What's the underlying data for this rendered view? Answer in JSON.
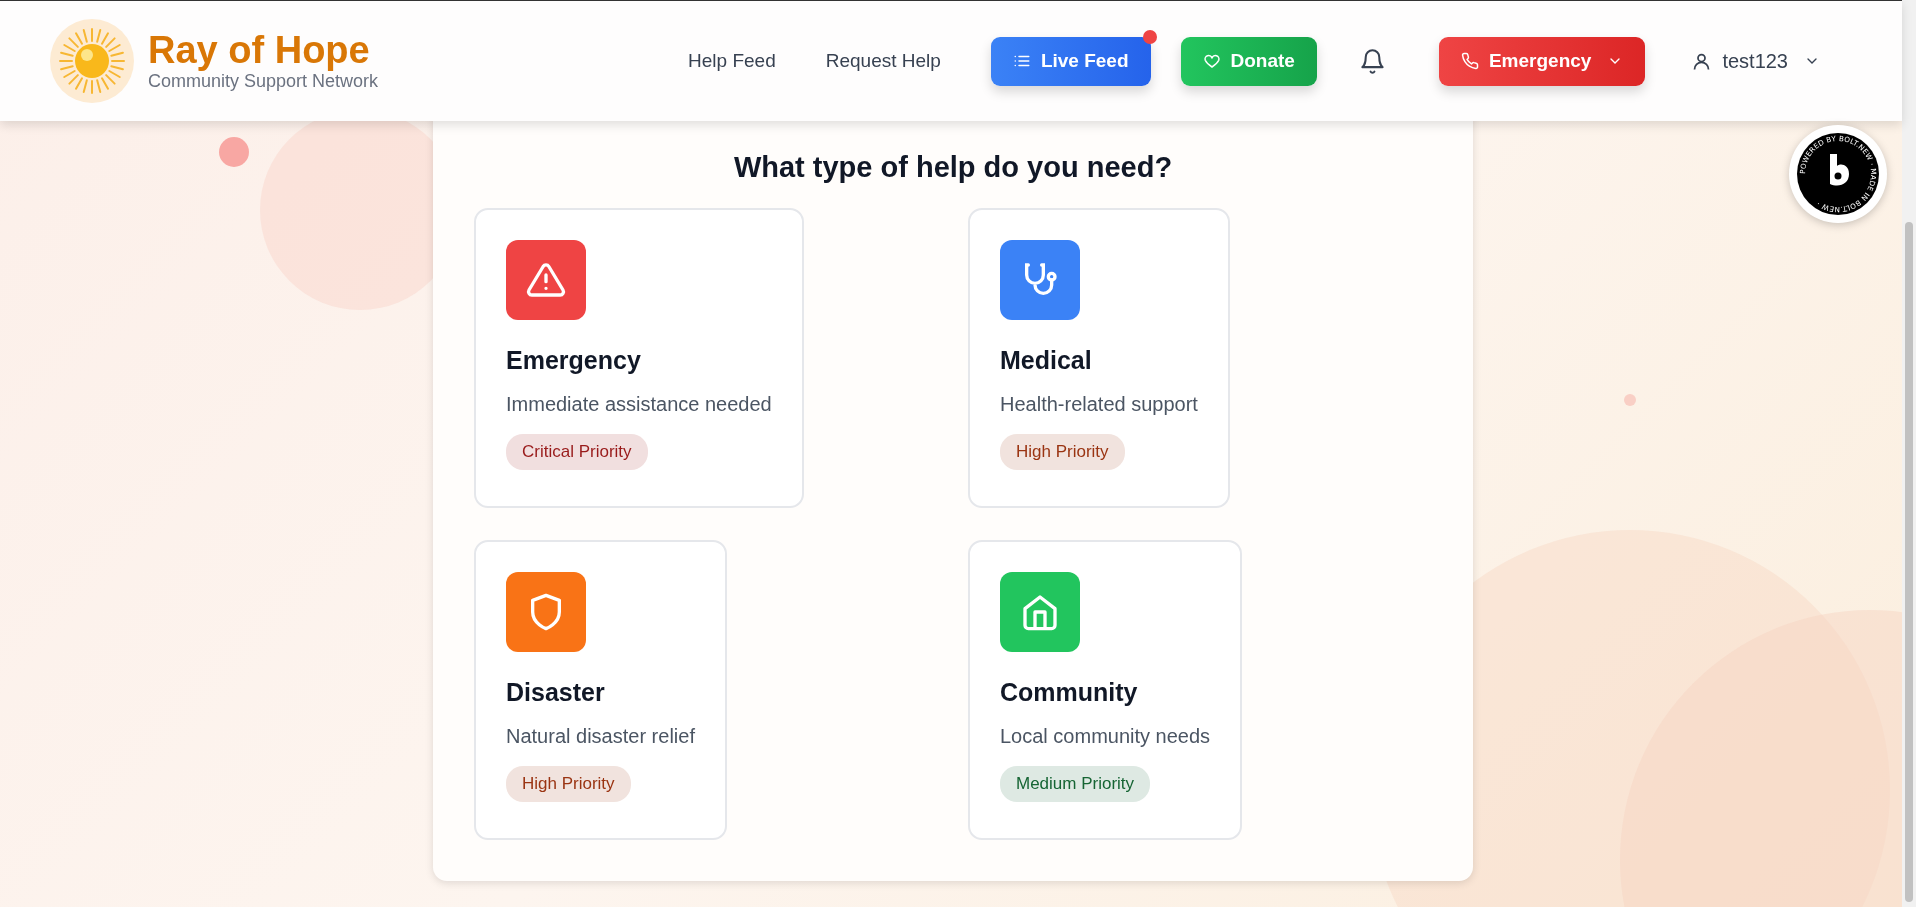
{
  "brand": {
    "title": "Ray of Hope",
    "subtitle": "Community Support Network"
  },
  "nav": [
    {
      "label": "Help Feed",
      "kind": "link"
    },
    {
      "label": "Request Help",
      "kind": "link"
    },
    {
      "label": "Live Feed",
      "kind": "live",
      "notification": true
    },
    {
      "label": "Donate",
      "kind": "donate"
    },
    {
      "kind": "bell"
    },
    {
      "label": "Emergency",
      "kind": "emergency"
    },
    {
      "label": "test123",
      "kind": "user"
    }
  ],
  "badge": {
    "text": "POWERED BY BOLT.NEW · MADE IN BOLT.NEW · "
  },
  "heading": "What type of help do you need?",
  "categories": [
    {
      "title": "Emergency",
      "description": "Immediate assistance needed",
      "color": "#ef4444",
      "priority": {
        "label": "Critical Priority",
        "color": "#991b1b"
      }
    },
    {
      "title": "Medical",
      "description": "Health-related support",
      "color": "#3b82f6",
      "priority": {
        "label": "High Priority",
        "color": "#9a3412"
      }
    },
    {
      "title": "Disaster",
      "description": "Natural disaster relief",
      "color": "#f97316",
      "priority": {
        "label": "High Priority",
        "color": "#9a3412"
      }
    },
    {
      "title": "Community",
      "description": "Local community needs",
      "color": "#22c55e",
      "priority": {
        "label": "Medium Priority",
        "color": "#166534"
      }
    }
  ]
}
